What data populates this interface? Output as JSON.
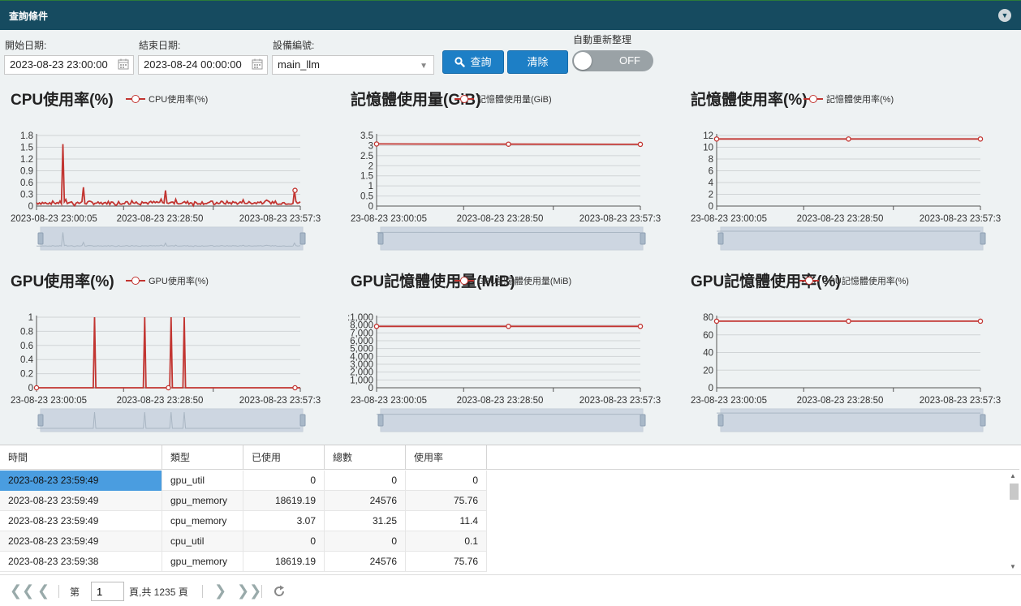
{
  "header": {
    "title": "查詢條件"
  },
  "query": {
    "start_label": "開始日期:",
    "start_value": "2023-08-23 23:00:00",
    "end_label": "結束日期:",
    "end_value": "2023-08-24 00:00:00",
    "device_label": "設備編號:",
    "device_value": "main_llm",
    "search_label": "查詢",
    "clear_label": "清除",
    "auto_label": "自動重新整理",
    "auto_value": "OFF"
  },
  "colors": {
    "series": "#c23531",
    "header": "#164b60",
    "button": "#1d7fc6"
  },
  "chart_data": [
    {
      "type": "line",
      "title": "CPU使用率(%)",
      "series": [
        {
          "name": "CPU使用率(%)"
        }
      ],
      "ylim": [
        0,
        1.8
      ],
      "yticks": [
        "0",
        "0.3",
        "0.6",
        "0.9",
        "1.2",
        "1.5",
        "1.8"
      ],
      "xticks": [
        "2023-08-23 23:00:05",
        "2023-08-23 23:28:50",
        "2023-08-23 23:57:3"
      ],
      "mode": "noisy",
      "base": 0.04,
      "spikes": [
        [
          0.1,
          1.58
        ],
        [
          0.18,
          0.48
        ],
        [
          0.49,
          0.4
        ],
        [
          0.98,
          0.4
        ]
      ],
      "points": []
    },
    {
      "type": "line",
      "title": "記憶體使用量(GiB)",
      "series": [
        {
          "name": "記憶體使用量(GiB)"
        }
      ],
      "ylim": [
        0,
        3.5
      ],
      "yticks": [
        "0",
        "0.5",
        "1",
        "1.5",
        "2",
        "2.5",
        "3",
        "3.5"
      ],
      "xticks": [
        "23-08-23 23:00:05",
        "2023-08-23 23:28:50",
        "2023-08-23 23:57:3"
      ],
      "mode": "points",
      "points": [
        [
          0,
          3.08
        ],
        [
          0.5,
          3.07
        ],
        [
          1,
          3.06
        ]
      ],
      "markers": [
        0,
        1,
        2
      ]
    },
    {
      "type": "line",
      "title": "記憶體使用率(%)",
      "series": [
        {
          "name": "記憶體使用率(%)"
        }
      ],
      "ylim": [
        0,
        12
      ],
      "yticks": [
        "0",
        "2",
        "4",
        "6",
        "8",
        "10",
        "12"
      ],
      "xticks": [
        "23-08-23 23:00:05",
        "2023-08-23 23:28:50",
        "2023-08-23 23:57:3"
      ],
      "mode": "points",
      "points": [
        [
          0,
          11.4
        ],
        [
          0.5,
          11.4
        ],
        [
          1,
          11.4
        ]
      ],
      "markers": [
        0,
        1,
        2
      ]
    },
    {
      "type": "line",
      "title": "GPU使用率(%)",
      "series": [
        {
          "name": "GPU使用率(%)"
        }
      ],
      "ylim": [
        0,
        1
      ],
      "yticks": [
        "0",
        "0.2",
        "0.4",
        "0.6",
        "0.8",
        "1"
      ],
      "xticks": [
        "23-08-23 23:00:05",
        "2023-08-23 23:28:50",
        "2023-08-23 23:57:3"
      ],
      "mode": "spikes",
      "base": 0,
      "spikes": [
        [
          0.22,
          1
        ],
        [
          0.41,
          1
        ],
        [
          0.51,
          1
        ],
        [
          0.56,
          1
        ]
      ],
      "markers_at": [
        0,
        0.5,
        0.98
      ],
      "points": []
    },
    {
      "type": "line",
      "title": "GPU記憶體使用量(MiB)",
      "series": [
        {
          "name": "GPU記憶體使用量(MiB)"
        }
      ],
      "ylim": [
        0,
        10000
      ],
      "yticks": [
        "0",
        "1,000",
        "2,000",
        "3,000",
        "4,000",
        "5,000",
        "6,000",
        "7,000",
        "8,000",
        ":1,000"
      ],
      "xticks": [
        "23-08-23 23:00:05",
        "2023-08-23 23:28:50",
        "2023-08-23 23:57:3"
      ],
      "mode": "points",
      "points": [
        [
          0,
          8700
        ],
        [
          0.5,
          8700
        ],
        [
          1,
          8700
        ]
      ],
      "markers": [
        0,
        1,
        2
      ]
    },
    {
      "type": "line",
      "title": "GPU記憶體使用率(%)",
      "series": [
        {
          "name": "GPU記憶體使用率(%)"
        }
      ],
      "ylim": [
        0,
        80
      ],
      "yticks": [
        "0",
        "20",
        "40",
        "60",
        "80"
      ],
      "xticks": [
        "23-08-23 23:00:05",
        "2023-08-23 23:28:50",
        "2023-08-23 23:57:3"
      ],
      "mode": "points",
      "points": [
        [
          0,
          75.5
        ],
        [
          0.5,
          75.5
        ],
        [
          1,
          75.5
        ]
      ],
      "markers": [
        0,
        1,
        2
      ]
    }
  ],
  "table": {
    "columns": [
      "時間",
      "類型",
      "已使用",
      "總數",
      "使用率"
    ],
    "rows": [
      [
        "2023-08-23 23:59:49",
        "gpu_util",
        "0",
        "0",
        "0"
      ],
      [
        "2023-08-23 23:59:49",
        "gpu_memory",
        "18619.19",
        "24576",
        "75.76"
      ],
      [
        "2023-08-23 23:59:49",
        "cpu_memory",
        "3.07",
        "31.25",
        "11.4"
      ],
      [
        "2023-08-23 23:59:49",
        "cpu_util",
        "0",
        "0",
        "0.1"
      ],
      [
        "2023-08-23 23:59:38",
        "gpu_memory",
        "18619.19",
        "24576",
        "75.76"
      ]
    ]
  },
  "pager": {
    "page_prefix": "第",
    "page_value": "1",
    "page_suffix": "頁,共 1235 頁"
  }
}
